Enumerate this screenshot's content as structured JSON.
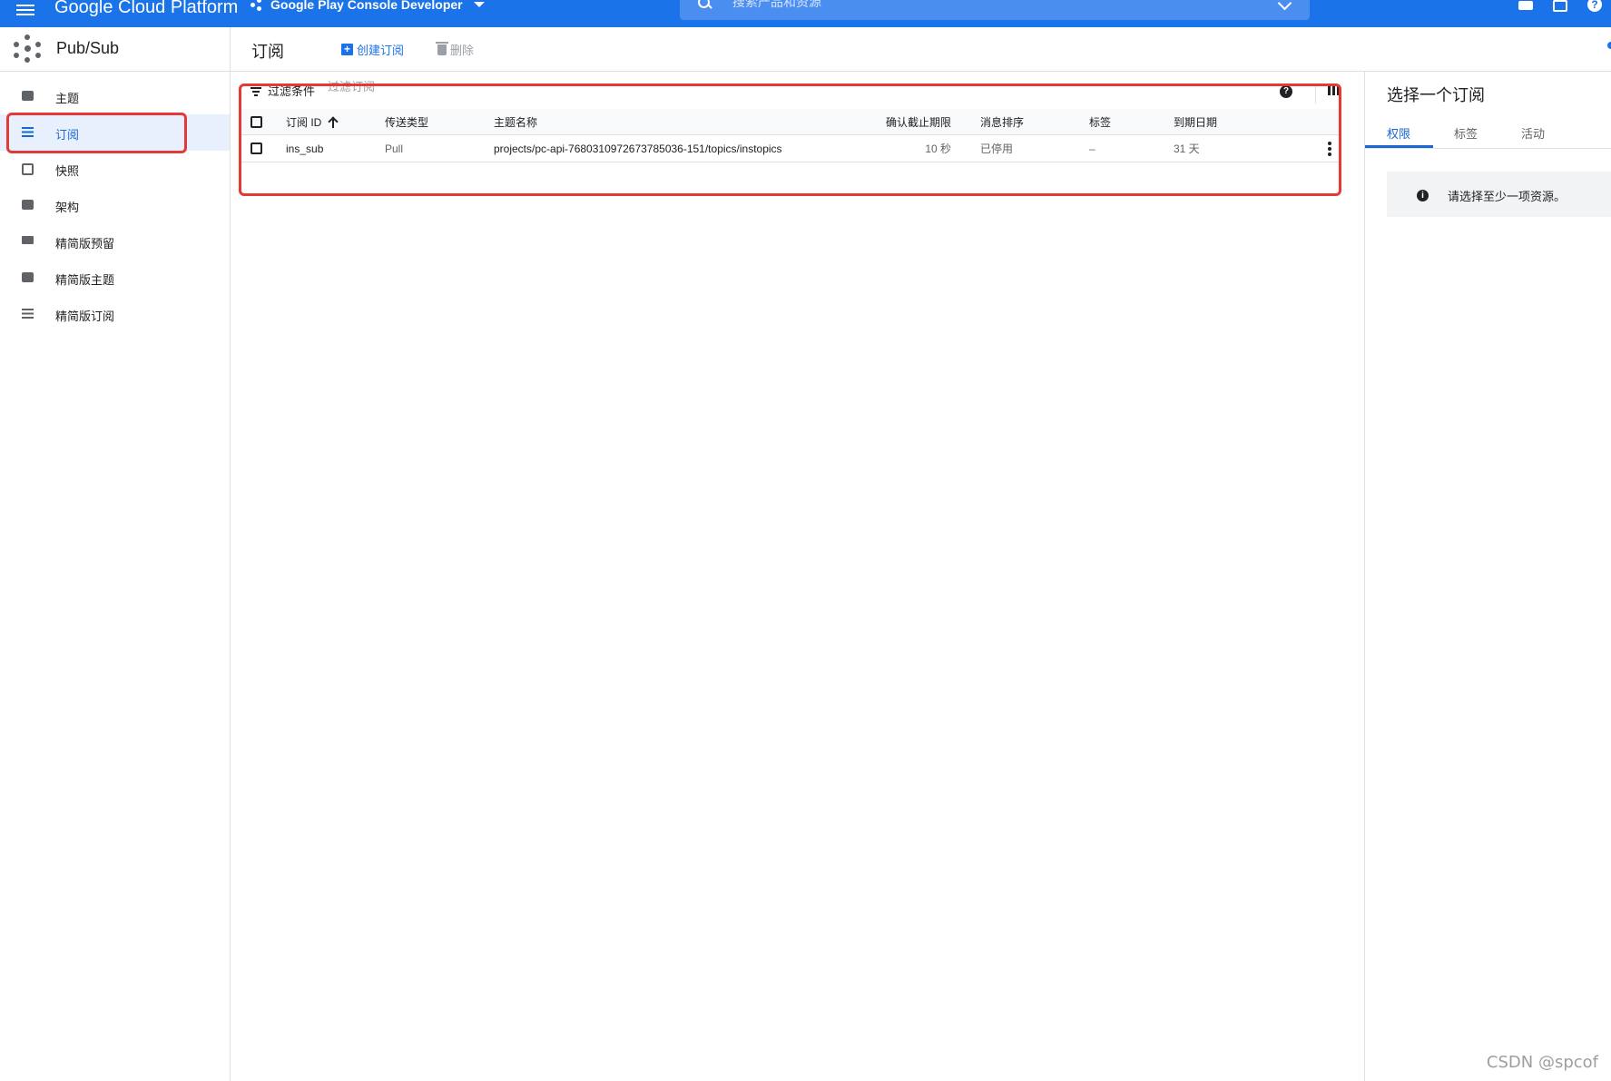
{
  "topbar": {
    "brand": "Google Cloud Platform",
    "project": "Google Play Console Developer",
    "search_placeholder": "搜索产品和资源",
    "help_glyph": "?"
  },
  "service": {
    "title": "Pub/Sub"
  },
  "nav": {
    "items": [
      {
        "label": "主题",
        "icon": "chat-icon"
      },
      {
        "label": "订阅",
        "icon": "list-icon",
        "active": true
      },
      {
        "label": "快照",
        "icon": "snapshot-icon"
      },
      {
        "label": "架构",
        "icon": "schema-icon"
      },
      {
        "label": "精简版预留",
        "icon": "reservation-icon"
      },
      {
        "label": "精简版主题",
        "icon": "chat-icon"
      },
      {
        "label": "精简版订阅",
        "icon": "list-icon"
      }
    ]
  },
  "page": {
    "title": "订阅",
    "create_label": "创建订阅",
    "delete_label": "删除",
    "filter_label": "过滤条件",
    "filter_placeholder": "过滤订阅",
    "help_glyph": "?"
  },
  "table": {
    "headers": {
      "id": "订阅 ID",
      "delivery": "传送类型",
      "topic": "主题名称",
      "ack": "确认截止期限",
      "ordering": "消息排序",
      "labels": "标签",
      "expiry": "到期日期"
    },
    "rows": [
      {
        "id": "ins_sub",
        "delivery": "Pull",
        "topic": "projects/pc-api-7680310972673785036-151/topics/instopics",
        "ack": "10 秒",
        "ordering": "已停用",
        "labels": "–",
        "expiry": "31 天"
      }
    ]
  },
  "right_panel": {
    "title": "选择一个订阅",
    "tabs": [
      "权限",
      "标签",
      "活动"
    ],
    "info_glyph": "i",
    "info_text": "请选择至少一项资源。"
  },
  "watermark": "CSDN @spcof",
  "colors": {
    "accent": "#1a73e8",
    "highlight": "#e53935"
  }
}
